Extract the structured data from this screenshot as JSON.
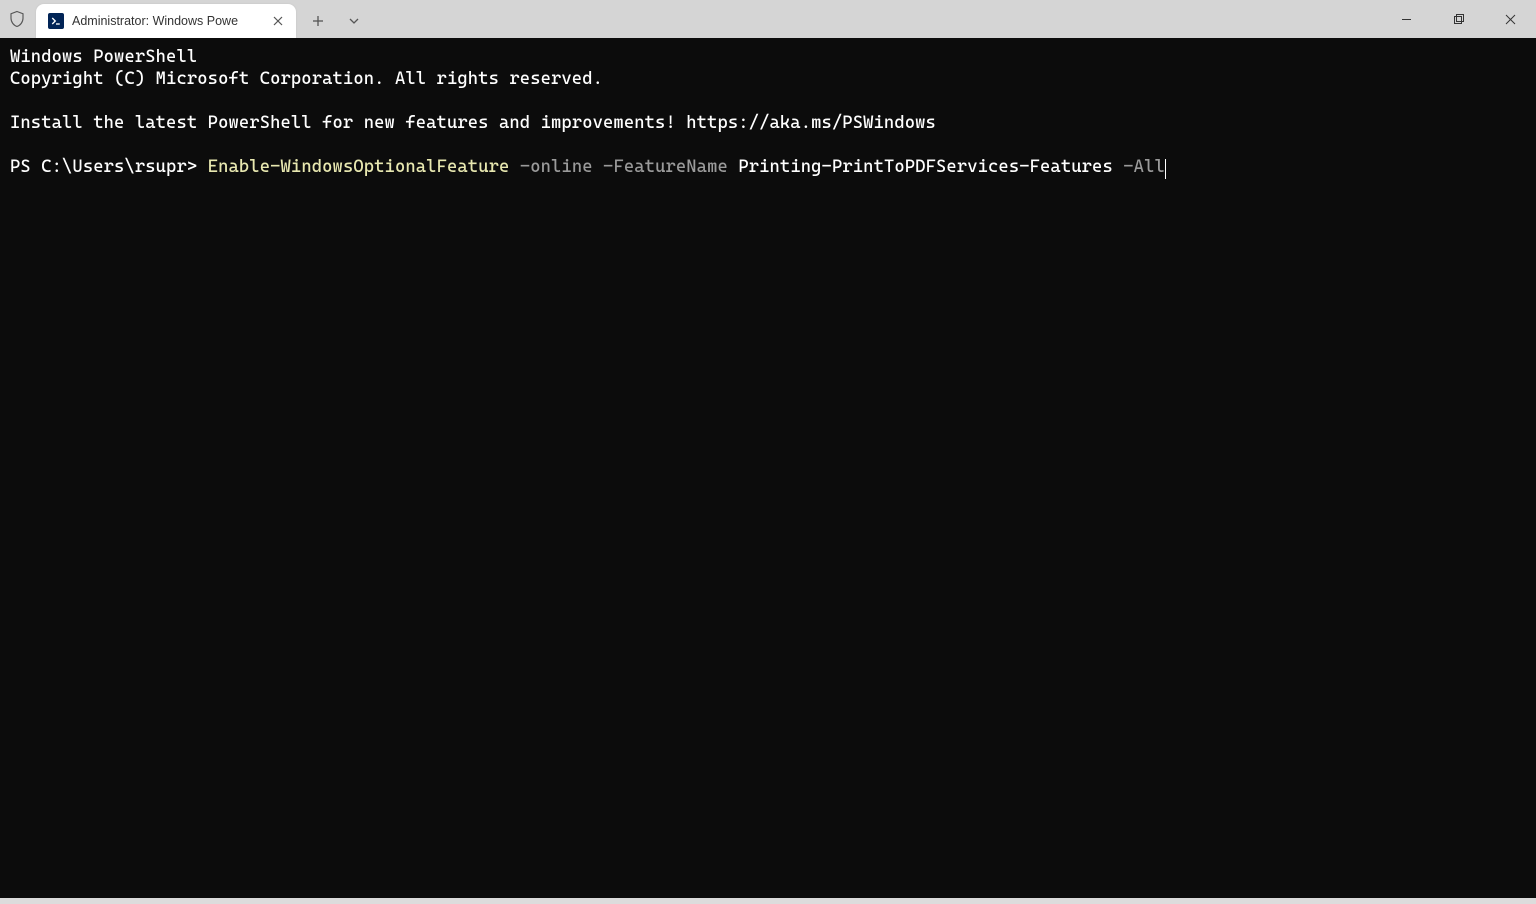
{
  "titlebar": {
    "tab_title": "Administrator: Windows Powe",
    "new_tab_label": "+",
    "dropdown_label": "▾",
    "minimize_label": "—",
    "maximize_label": "□",
    "close_label": "✕"
  },
  "terminal": {
    "line1": "Windows PowerShell",
    "line2": "Copyright (C) Microsoft Corporation. All rights reserved.",
    "line3": "",
    "line4": "Install the latest PowerShell for new features and improvements! https://aka.ms/PSWindows",
    "line5": "",
    "prompt": "PS C:\\Users\\rsupr> ",
    "cmd_command": "Enable-WindowsOptionalFeature ",
    "cmd_param1": "-online ",
    "cmd_param2": "-FeatureName ",
    "cmd_value": "Printing-PrintToPDFServices-Features ",
    "cmd_param3": "-All"
  }
}
